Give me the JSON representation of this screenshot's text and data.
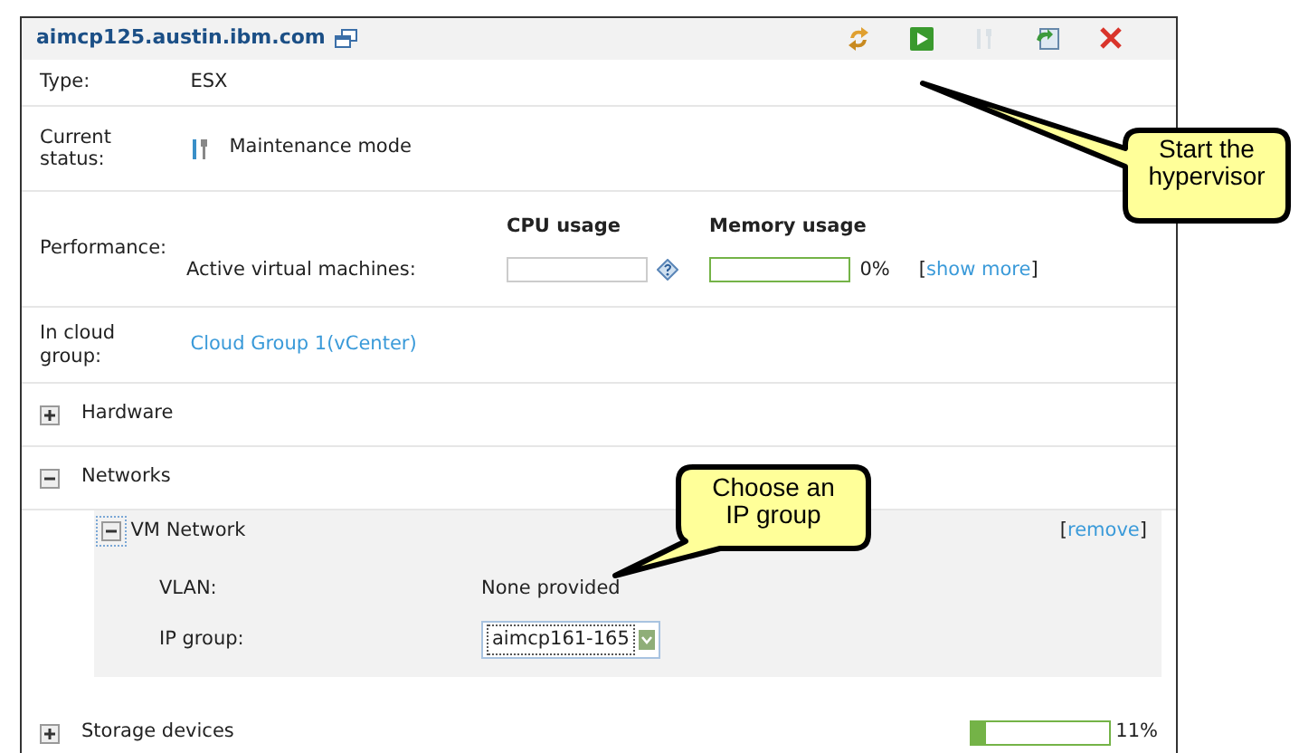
{
  "header": {
    "title": "aimcp125.austin.ibm.com",
    "actions": [
      {
        "kind": "arrows",
        "disabled": false
      },
      {
        "kind": "play",
        "disabled": false
      },
      {
        "kind": "tools",
        "disabled": true
      },
      {
        "kind": "sync",
        "disabled": false
      },
      {
        "kind": "close",
        "disabled": false
      }
    ]
  },
  "properties": [
    {
      "kind": "text",
      "label": "Type:",
      "value": "ESX"
    },
    {
      "kind": "status",
      "label": "Current status:",
      "value": "Maintenance mode"
    },
    {
      "kind": "performance",
      "label": "Performance:",
      "row_label": "Active virtual machines:",
      "cpu": {
        "heading": "CPU usage"
      },
      "memory": {
        "heading": "Memory usage",
        "reading": "0%"
      },
      "more_link": {
        "open": "[",
        "text": "show more",
        "close": "]"
      }
    },
    {
      "kind": "link",
      "label": "In cloud group:",
      "value": "Cloud Group 1(vCenter)"
    }
  ],
  "sections": [
    {
      "title": "Hardware",
      "expanded": false
    },
    {
      "title": "Networks",
      "expanded": true,
      "networks": [
        {
          "name": "VM Network",
          "expanded": true,
          "remove_link": {
            "open": "[",
            "text": "remove",
            "close": "]"
          },
          "vlan_label": "VLAN:",
          "vlan_value": "None provided",
          "ip_label": "IP group:",
          "ip_value": "aimcp161-165"
        }
      ]
    },
    {
      "title": "Storage devices",
      "expanded": false,
      "level": 0.11,
      "reading": "11%"
    }
  ],
  "callouts": [
    {
      "lines": [
        "Start the",
        "hypervisor"
      ]
    },
    {
      "lines": [
        "Choose an",
        "IP group"
      ]
    }
  ]
}
